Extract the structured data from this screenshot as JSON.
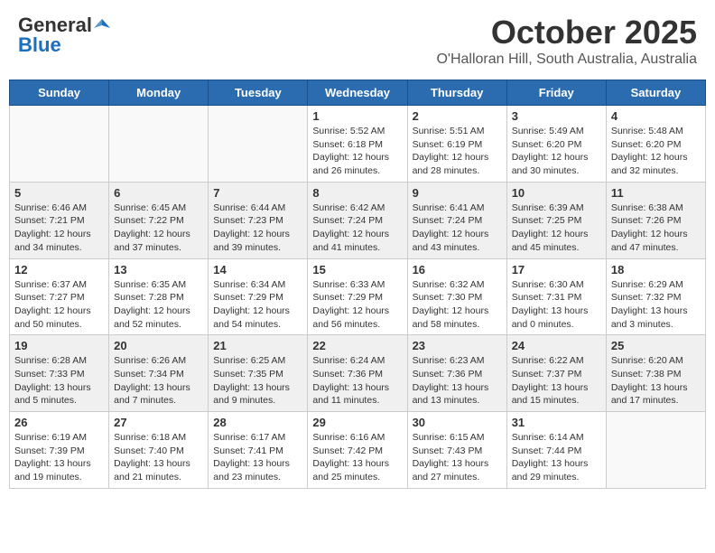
{
  "header": {
    "logo_general": "General",
    "logo_blue": "Blue",
    "month": "October 2025",
    "location": "O'Halloran Hill, South Australia, Australia"
  },
  "days_of_week": [
    "Sunday",
    "Monday",
    "Tuesday",
    "Wednesday",
    "Thursday",
    "Friday",
    "Saturday"
  ],
  "weeks": [
    [
      {
        "day": "",
        "info": ""
      },
      {
        "day": "",
        "info": ""
      },
      {
        "day": "",
        "info": ""
      },
      {
        "day": "1",
        "info": "Sunrise: 5:52 AM\nSunset: 6:18 PM\nDaylight: 12 hours\nand 26 minutes."
      },
      {
        "day": "2",
        "info": "Sunrise: 5:51 AM\nSunset: 6:19 PM\nDaylight: 12 hours\nand 28 minutes."
      },
      {
        "day": "3",
        "info": "Sunrise: 5:49 AM\nSunset: 6:20 PM\nDaylight: 12 hours\nand 30 minutes."
      },
      {
        "day": "4",
        "info": "Sunrise: 5:48 AM\nSunset: 6:20 PM\nDaylight: 12 hours\nand 32 minutes."
      }
    ],
    [
      {
        "day": "5",
        "info": "Sunrise: 6:46 AM\nSunset: 7:21 PM\nDaylight: 12 hours\nand 34 minutes."
      },
      {
        "day": "6",
        "info": "Sunrise: 6:45 AM\nSunset: 7:22 PM\nDaylight: 12 hours\nand 37 minutes."
      },
      {
        "day": "7",
        "info": "Sunrise: 6:44 AM\nSunset: 7:23 PM\nDaylight: 12 hours\nand 39 minutes."
      },
      {
        "day": "8",
        "info": "Sunrise: 6:42 AM\nSunset: 7:24 PM\nDaylight: 12 hours\nand 41 minutes."
      },
      {
        "day": "9",
        "info": "Sunrise: 6:41 AM\nSunset: 7:24 PM\nDaylight: 12 hours\nand 43 minutes."
      },
      {
        "day": "10",
        "info": "Sunrise: 6:39 AM\nSunset: 7:25 PM\nDaylight: 12 hours\nand 45 minutes."
      },
      {
        "day": "11",
        "info": "Sunrise: 6:38 AM\nSunset: 7:26 PM\nDaylight: 12 hours\nand 47 minutes."
      }
    ],
    [
      {
        "day": "12",
        "info": "Sunrise: 6:37 AM\nSunset: 7:27 PM\nDaylight: 12 hours\nand 50 minutes."
      },
      {
        "day": "13",
        "info": "Sunrise: 6:35 AM\nSunset: 7:28 PM\nDaylight: 12 hours\nand 52 minutes."
      },
      {
        "day": "14",
        "info": "Sunrise: 6:34 AM\nSunset: 7:29 PM\nDaylight: 12 hours\nand 54 minutes."
      },
      {
        "day": "15",
        "info": "Sunrise: 6:33 AM\nSunset: 7:29 PM\nDaylight: 12 hours\nand 56 minutes."
      },
      {
        "day": "16",
        "info": "Sunrise: 6:32 AM\nSunset: 7:30 PM\nDaylight: 12 hours\nand 58 minutes."
      },
      {
        "day": "17",
        "info": "Sunrise: 6:30 AM\nSunset: 7:31 PM\nDaylight: 13 hours\nand 0 minutes."
      },
      {
        "day": "18",
        "info": "Sunrise: 6:29 AM\nSunset: 7:32 PM\nDaylight: 13 hours\nand 3 minutes."
      }
    ],
    [
      {
        "day": "19",
        "info": "Sunrise: 6:28 AM\nSunset: 7:33 PM\nDaylight: 13 hours\nand 5 minutes."
      },
      {
        "day": "20",
        "info": "Sunrise: 6:26 AM\nSunset: 7:34 PM\nDaylight: 13 hours\nand 7 minutes."
      },
      {
        "day": "21",
        "info": "Sunrise: 6:25 AM\nSunset: 7:35 PM\nDaylight: 13 hours\nand 9 minutes."
      },
      {
        "day": "22",
        "info": "Sunrise: 6:24 AM\nSunset: 7:36 PM\nDaylight: 13 hours\nand 11 minutes."
      },
      {
        "day": "23",
        "info": "Sunrise: 6:23 AM\nSunset: 7:36 PM\nDaylight: 13 hours\nand 13 minutes."
      },
      {
        "day": "24",
        "info": "Sunrise: 6:22 AM\nSunset: 7:37 PM\nDaylight: 13 hours\nand 15 minutes."
      },
      {
        "day": "25",
        "info": "Sunrise: 6:20 AM\nSunset: 7:38 PM\nDaylight: 13 hours\nand 17 minutes."
      }
    ],
    [
      {
        "day": "26",
        "info": "Sunrise: 6:19 AM\nSunset: 7:39 PM\nDaylight: 13 hours\nand 19 minutes."
      },
      {
        "day": "27",
        "info": "Sunrise: 6:18 AM\nSunset: 7:40 PM\nDaylight: 13 hours\nand 21 minutes."
      },
      {
        "day": "28",
        "info": "Sunrise: 6:17 AM\nSunset: 7:41 PM\nDaylight: 13 hours\nand 23 minutes."
      },
      {
        "day": "29",
        "info": "Sunrise: 6:16 AM\nSunset: 7:42 PM\nDaylight: 13 hours\nand 25 minutes."
      },
      {
        "day": "30",
        "info": "Sunrise: 6:15 AM\nSunset: 7:43 PM\nDaylight: 13 hours\nand 27 minutes."
      },
      {
        "day": "31",
        "info": "Sunrise: 6:14 AM\nSunset: 7:44 PM\nDaylight: 13 hours\nand 29 minutes."
      },
      {
        "day": "",
        "info": ""
      }
    ]
  ]
}
